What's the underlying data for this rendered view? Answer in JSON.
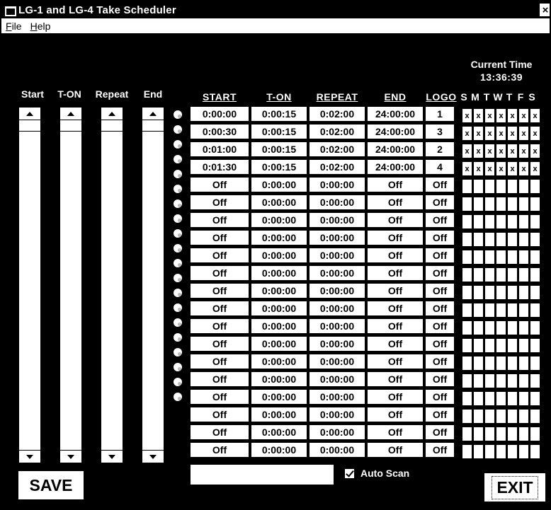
{
  "window": {
    "title": "LG-1 and LG-4 Take Scheduler",
    "close_glyph": "×"
  },
  "menu": [
    {
      "first": "F",
      "rest": "ile"
    },
    {
      "first": "H",
      "rest": "elp"
    }
  ],
  "clock": {
    "label": "Current Time",
    "value": "13:36:39"
  },
  "scroll_labels": [
    "Start",
    "T-ON",
    "Repeat",
    "End"
  ],
  "headers": {
    "start": "START",
    "ton": "T-ON",
    "repeat": "REPEAT",
    "end": "END",
    "logo": "LOGO"
  },
  "days": [
    "S",
    "M",
    "T",
    "W",
    "T",
    "F",
    "S"
  ],
  "rows": [
    {
      "start": "0:00:00",
      "ton": "0:00:15",
      "repeat": "0:02:00",
      "end": "24:00:00",
      "logo": "1",
      "days": [
        "x",
        "x",
        "x",
        "x",
        "x",
        "x",
        "x"
      ]
    },
    {
      "start": "0:00:30",
      "ton": "0:00:15",
      "repeat": "0:02:00",
      "end": "24:00:00",
      "logo": "3",
      "days": [
        "x",
        "x",
        "x",
        "x",
        "x",
        "x",
        "x"
      ]
    },
    {
      "start": "0:01:00",
      "ton": "0:00:15",
      "repeat": "0:02:00",
      "end": "24:00:00",
      "logo": "2",
      "days": [
        "x",
        "x",
        "x",
        "x",
        "x",
        "x",
        "x"
      ]
    },
    {
      "start": "0:01:30",
      "ton": "0:00:15",
      "repeat": "0:02:00",
      "end": "24:00:00",
      "logo": "4",
      "days": [
        "x",
        "x",
        "x",
        "x",
        "x",
        "x",
        "x"
      ]
    },
    {
      "start": "Off",
      "ton": "0:00:00",
      "repeat": "0:00:00",
      "end": "Off",
      "logo": "Off",
      "days": [
        "",
        "",
        "",
        "",
        "",
        "",
        ""
      ]
    },
    {
      "start": "Off",
      "ton": "0:00:00",
      "repeat": "0:00:00",
      "end": "Off",
      "logo": "Off",
      "days": [
        "",
        "",
        "",
        "",
        "",
        "",
        ""
      ]
    },
    {
      "start": "Off",
      "ton": "0:00:00",
      "repeat": "0:00:00",
      "end": "Off",
      "logo": "Off",
      "days": [
        "",
        "",
        "",
        "",
        "",
        "",
        ""
      ]
    },
    {
      "start": "Off",
      "ton": "0:00:00",
      "repeat": "0:00:00",
      "end": "Off",
      "logo": "Off",
      "days": [
        "",
        "",
        "",
        "",
        "",
        "",
        ""
      ]
    },
    {
      "start": "Off",
      "ton": "0:00:00",
      "repeat": "0:00:00",
      "end": "Off",
      "logo": "Off",
      "days": [
        "",
        "",
        "",
        "",
        "",
        "",
        ""
      ]
    },
    {
      "start": "Off",
      "ton": "0:00:00",
      "repeat": "0:00:00",
      "end": "Off",
      "logo": "Off",
      "days": [
        "",
        "",
        "",
        "",
        "",
        "",
        ""
      ]
    },
    {
      "start": "Off",
      "ton": "0:00:00",
      "repeat": "0:00:00",
      "end": "Off",
      "logo": "Off",
      "days": [
        "",
        "",
        "",
        "",
        "",
        "",
        ""
      ]
    },
    {
      "start": "Off",
      "ton": "0:00:00",
      "repeat": "0:00:00",
      "end": "Off",
      "logo": "Off",
      "days": [
        "",
        "",
        "",
        "",
        "",
        "",
        ""
      ]
    },
    {
      "start": "Off",
      "ton": "0:00:00",
      "repeat": "0:00:00",
      "end": "Off",
      "logo": "Off",
      "days": [
        "",
        "",
        "",
        "",
        "",
        "",
        ""
      ]
    },
    {
      "start": "Off",
      "ton": "0:00:00",
      "repeat": "0:00:00",
      "end": "Off",
      "logo": "Off",
      "days": [
        "",
        "",
        "",
        "",
        "",
        "",
        ""
      ]
    },
    {
      "start": "Off",
      "ton": "0:00:00",
      "repeat": "0:00:00",
      "end": "Off",
      "logo": "Off",
      "days": [
        "",
        "",
        "",
        "",
        "",
        "",
        ""
      ]
    },
    {
      "start": "Off",
      "ton": "0:00:00",
      "repeat": "0:00:00",
      "end": "Off",
      "logo": "Off",
      "days": [
        "",
        "",
        "",
        "",
        "",
        "",
        ""
      ]
    },
    {
      "start": "Off",
      "ton": "0:00:00",
      "repeat": "0:00:00",
      "end": "Off",
      "logo": "Off",
      "days": [
        "",
        "",
        "",
        "",
        "",
        "",
        ""
      ]
    },
    {
      "start": "Off",
      "ton": "0:00:00",
      "repeat": "0:00:00",
      "end": "Off",
      "logo": "Off",
      "days": [
        "",
        "",
        "",
        "",
        "",
        "",
        ""
      ]
    },
    {
      "start": "Off",
      "ton": "0:00:00",
      "repeat": "0:00:00",
      "end": "Off",
      "logo": "Off",
      "days": [
        "",
        "",
        "",
        "",
        "",
        "",
        ""
      ]
    },
    {
      "start": "Off",
      "ton": "0:00:00",
      "repeat": "0:00:00",
      "end": "Off",
      "logo": "Off",
      "days": [
        "",
        "",
        "",
        "",
        "",
        "",
        ""
      ]
    }
  ],
  "buttons": {
    "save": "SAVE",
    "exit": "EXIT"
  },
  "auto_scan": {
    "label": "Auto Scan",
    "checked": true
  },
  "status_field": {
    "value": ""
  },
  "colors": {
    "background": "#000000",
    "foreground": "#ffffff"
  },
  "icons": {
    "window_icon": "app-window-icon",
    "scroll_up": "arrow-up-icon",
    "scroll_down": "arrow-down-icon"
  }
}
